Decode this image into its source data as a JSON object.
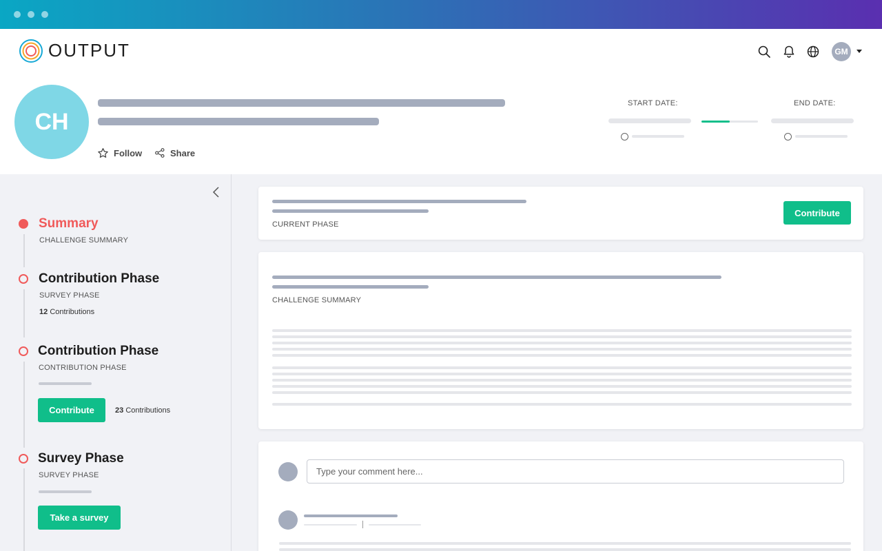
{
  "window": {
    "title": ""
  },
  "brand": {
    "name": "OUTPUT"
  },
  "header": {
    "user_initials": "GM",
    "challenge_initials": "CH",
    "follow_label": "Follow",
    "share_label": "Share",
    "start_date_label": "START DATE:",
    "end_date_label": "END DATE:",
    "timeline_progress": 0.5
  },
  "sidebar": {
    "phases": [
      {
        "title": "Summary",
        "subtitle": "CHALLENGE SUMMARY",
        "active": true
      },
      {
        "title": "Contribution Phase",
        "subtitle": "SURVEY PHASE",
        "count": "12",
        "count_label": "Contributions"
      },
      {
        "title": "Contribution Phase",
        "subtitle": "CONTRIBUTION PHASE",
        "button": "Contribute",
        "count": "23",
        "count_label": "Contributions"
      },
      {
        "title": "Survey Phase",
        "subtitle": "SURVEY PHASE",
        "button": "Take a survey"
      }
    ]
  },
  "main": {
    "current_phase_label": "CURRENT PHASE",
    "contribute_label": "Contribute",
    "summary_label": "CHALLENGE SUMMARY",
    "comment_placeholder": "Type your comment here..."
  },
  "colors": {
    "accent": "#f05a5a",
    "primary_button": "#10be8a",
    "avatar": "#7fd7e6"
  }
}
